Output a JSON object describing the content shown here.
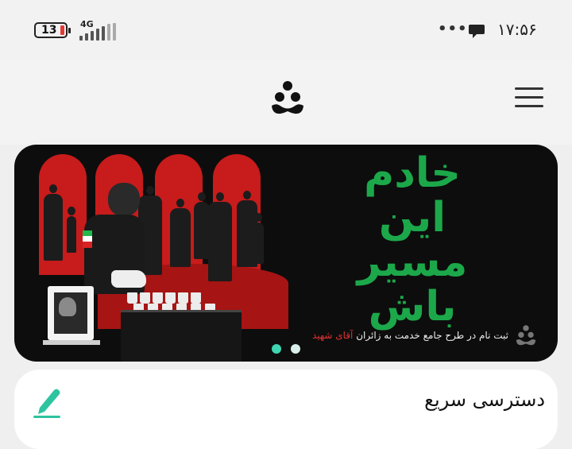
{
  "status_bar": {
    "time": "۱۷:۵۶",
    "battery": "13",
    "network_type": "4G",
    "more": "•••",
    "icons": [
      "battery-icon",
      "signal-icon",
      "chat-bubble-icon",
      "more-dots-icon"
    ]
  },
  "header": {
    "logo_icon": "app-logo-icon",
    "menu_icon": "hamburger-menu-icon"
  },
  "banner": {
    "headline_lines": [
      "خادم",
      "این",
      "مسیر",
      "باش"
    ],
    "caption_main": "ثبت نام در طرح جامع خدمت به زائران",
    "caption_highlight": "آقای شهید",
    "colors": {
      "headline": "#1ca84a",
      "highlight": "#e03131",
      "arch": "#c81b1b",
      "background": "#0d0d0d"
    },
    "carousel": {
      "total": 2,
      "active_index": 0,
      "active_color": "#3dd6b0",
      "inactive_color": "#d9efe9"
    }
  },
  "quick_access": {
    "title": "دسترسی سریع",
    "icon": "edit-pencil-icon",
    "accent": "#2ec4a0"
  }
}
